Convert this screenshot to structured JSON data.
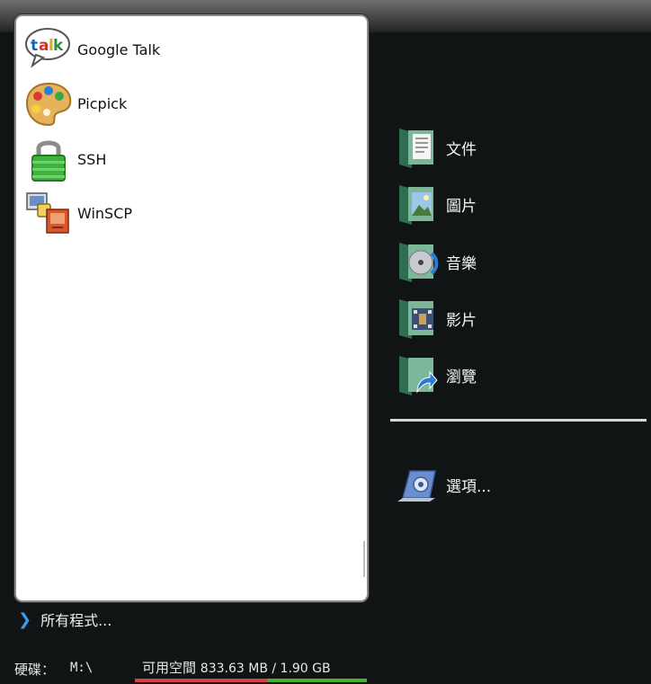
{
  "programs": [
    {
      "label": "Google Talk",
      "icon": "google-talk-icon"
    },
    {
      "label": "Picpick",
      "icon": "picpick-palette-icon"
    },
    {
      "label": "SSH",
      "icon": "padlock-icon"
    },
    {
      "label": "WinSCP",
      "icon": "winscp-icon"
    }
  ],
  "all_programs": {
    "label": "所有程式...",
    "icon": "chevron-right-icon"
  },
  "places": [
    {
      "label": "文件",
      "icon": "documents-folder-icon"
    },
    {
      "label": "圖片",
      "icon": "pictures-folder-icon"
    },
    {
      "label": "音樂",
      "icon": "music-folder-icon"
    },
    {
      "label": "影片",
      "icon": "videos-folder-icon"
    },
    {
      "label": "瀏覽",
      "icon": "browse-folder-icon"
    }
  ],
  "options": {
    "label": "選項...",
    "icon": "options-icon"
  },
  "disk": {
    "label": "硬碟：",
    "path": "M:\\",
    "free_label": "可用空間",
    "free_value": "833.63 MB / 1.90 GB",
    "used_fraction": 0.57
  },
  "colors": {
    "background": "#111414",
    "accent_arrow": "#3a9be8",
    "used_bar": "#d64040",
    "free_bar": "#4caf35"
  }
}
